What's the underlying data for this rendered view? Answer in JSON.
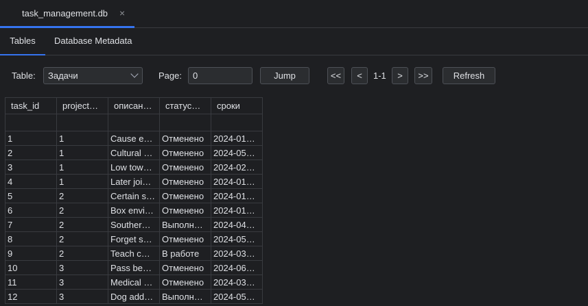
{
  "file_tab": {
    "name": "task_management.db",
    "close": "×"
  },
  "subtabs": [
    {
      "label": "Tables"
    },
    {
      "label": "Database Metadata"
    }
  ],
  "toolbar": {
    "table_label": "Table:",
    "table_value": "Задачи",
    "page_label": "Page:",
    "page_value": "0",
    "jump": "Jump",
    "first": "<<",
    "prev": "<",
    "page_info": "1-1",
    "next": ">",
    "last": ">>",
    "refresh": "Refresh"
  },
  "grid": {
    "columns": [
      "task_id",
      "project…",
      "описан…",
      "статус…",
      "сроки"
    ],
    "rows": [
      [
        "1",
        "1",
        "Cause e…",
        "Отменено",
        "2024-01…"
      ],
      [
        "2",
        "1",
        "Cultural …",
        "Отменено",
        "2024-05…"
      ],
      [
        "3",
        "1",
        "Low tow…",
        "Отменено",
        "2024-02…"
      ],
      [
        "4",
        "1",
        "Later joi…",
        "Отменено",
        "2024-01…"
      ],
      [
        "5",
        "2",
        "Certain s…",
        "Отменено",
        "2024-01…"
      ],
      [
        "6",
        "2",
        "Box envi…",
        "Отменено",
        "2024-01…"
      ],
      [
        "7",
        "2",
        "Souther…",
        "Выполн…",
        "2024-04…"
      ],
      [
        "8",
        "2",
        "Forget s…",
        "Отменено",
        "2024-05…"
      ],
      [
        "9",
        "2",
        "Teach c…",
        "В работе",
        "2024-03…"
      ],
      [
        "10",
        "3",
        "Pass be…",
        "Отменено",
        "2024-06…"
      ],
      [
        "11",
        "3",
        "Medical …",
        "Отменено",
        "2024-03…"
      ],
      [
        "12",
        "3",
        "Dog add…",
        "Выполн…",
        "2024-05…"
      ]
    ]
  },
  "colors": {
    "accent": "#3574f0",
    "background": "#1e1f22",
    "border": "#393b40"
  }
}
